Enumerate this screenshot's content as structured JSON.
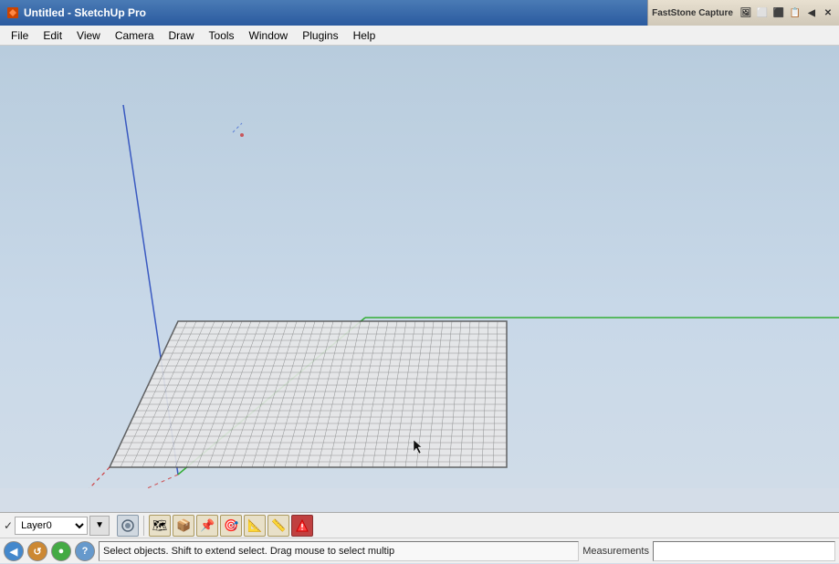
{
  "titlebar": {
    "title": "Untitled - SketchUp Pro",
    "icon": "🏠",
    "faststone_label": "FastStone Capture",
    "win_btns": [
      "─",
      "□",
      "✕"
    ]
  },
  "menubar": {
    "items": [
      "File",
      "Edit",
      "View",
      "Camera",
      "Draw",
      "Tools",
      "Window",
      "Plugins",
      "Help"
    ]
  },
  "toolbar": {
    "layer_check": "✓",
    "layer_name": "Layer0",
    "icons": [
      "📋",
      "📦",
      "🔨",
      "🎯",
      "📐",
      "📏",
      "⬡"
    ]
  },
  "statusbar": {
    "status_text": "Select objects. Shift to extend select. Drag mouse to select multip",
    "measurements_label": "Measurements",
    "buttons": [
      "◀",
      "↺",
      "●",
      "?"
    ]
  },
  "scene": {
    "grid_color": "#888",
    "axis_x_color": "#cc0000",
    "axis_y_color": "#00aa00",
    "axis_z_color": "#0000cc"
  }
}
